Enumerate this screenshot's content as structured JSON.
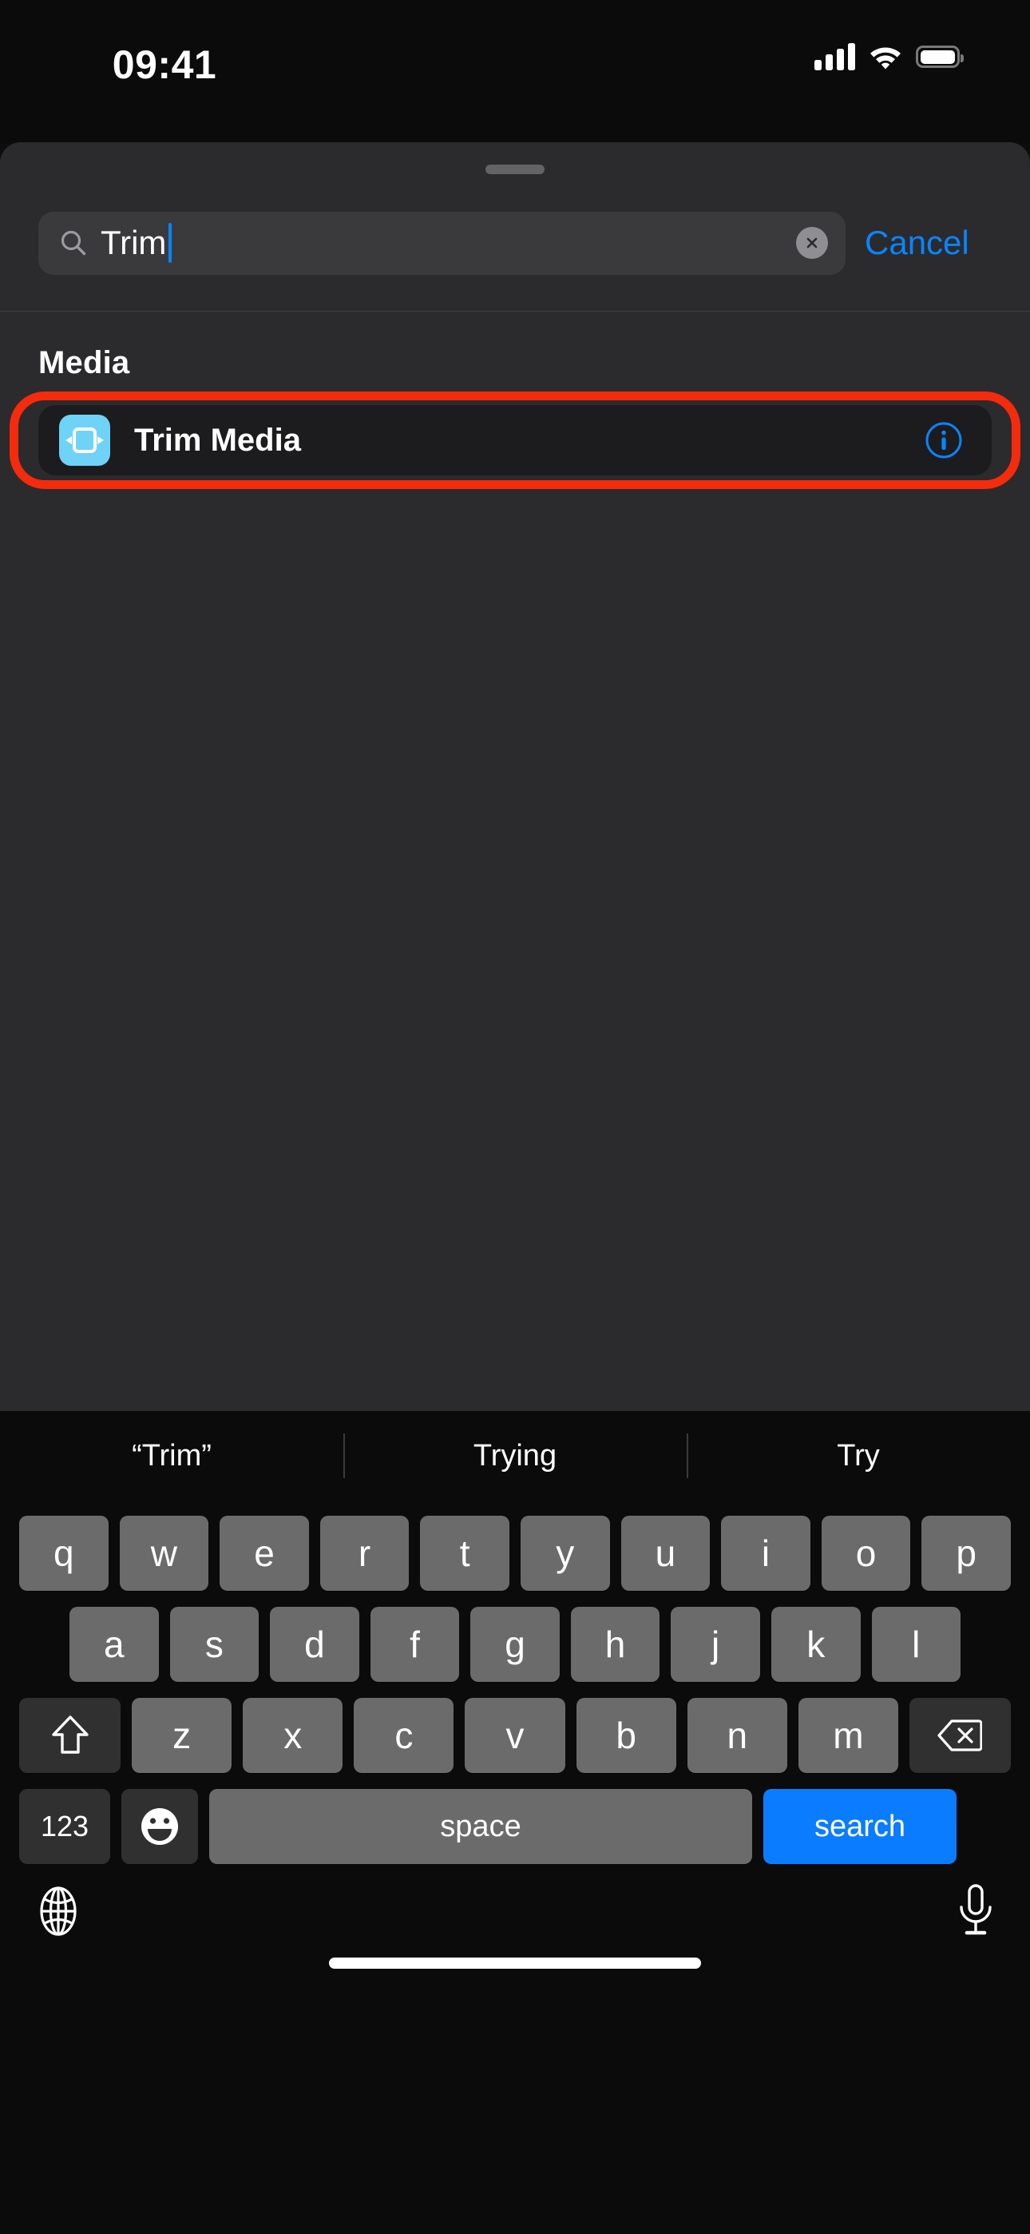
{
  "status_bar": {
    "time": "09:41",
    "icons": [
      "cellular-signal-icon",
      "wifi-icon",
      "battery-icon"
    ]
  },
  "sheet": {
    "grabber": "sheet-grabber-handle"
  },
  "search": {
    "icon": "search-icon",
    "value": "Trim",
    "placeholder": "Search",
    "clear_icon": "clear-text-icon",
    "cancel_label": "Cancel",
    "cancel_color": "#0a84ff",
    "caret_color": "#0a84ff"
  },
  "results": {
    "section_header": "Media",
    "items": [
      {
        "icon": "trim-media-icon",
        "icon_bg": "#6fd2f7",
        "label": "Trim Media",
        "info_icon": "info-circle-icon",
        "info_color": "#0a84ff",
        "highlighted": true,
        "highlight_color": "#f42b0c"
      }
    ]
  },
  "keyboard": {
    "suggestions": [
      "“Trim”",
      "Trying",
      "Try"
    ],
    "row1": [
      "q",
      "w",
      "e",
      "r",
      "t",
      "y",
      "u",
      "i",
      "o",
      "p"
    ],
    "row2": [
      "a",
      "s",
      "d",
      "f",
      "g",
      "h",
      "j",
      "k",
      "l"
    ],
    "row3": {
      "shift": "shift-icon",
      "letters": [
        "z",
        "x",
        "c",
        "v",
        "b",
        "n",
        "m"
      ],
      "backspace": "backspace-icon"
    },
    "row4": {
      "numbers_label": "123",
      "emoji": "emoji-icon",
      "space_label": "space",
      "return_label": "search",
      "return_color": "#0a7cff"
    },
    "bottom": {
      "globe": "globe-icon",
      "dictation": "microphone-icon"
    }
  },
  "home_indicator": "home-indicator"
}
